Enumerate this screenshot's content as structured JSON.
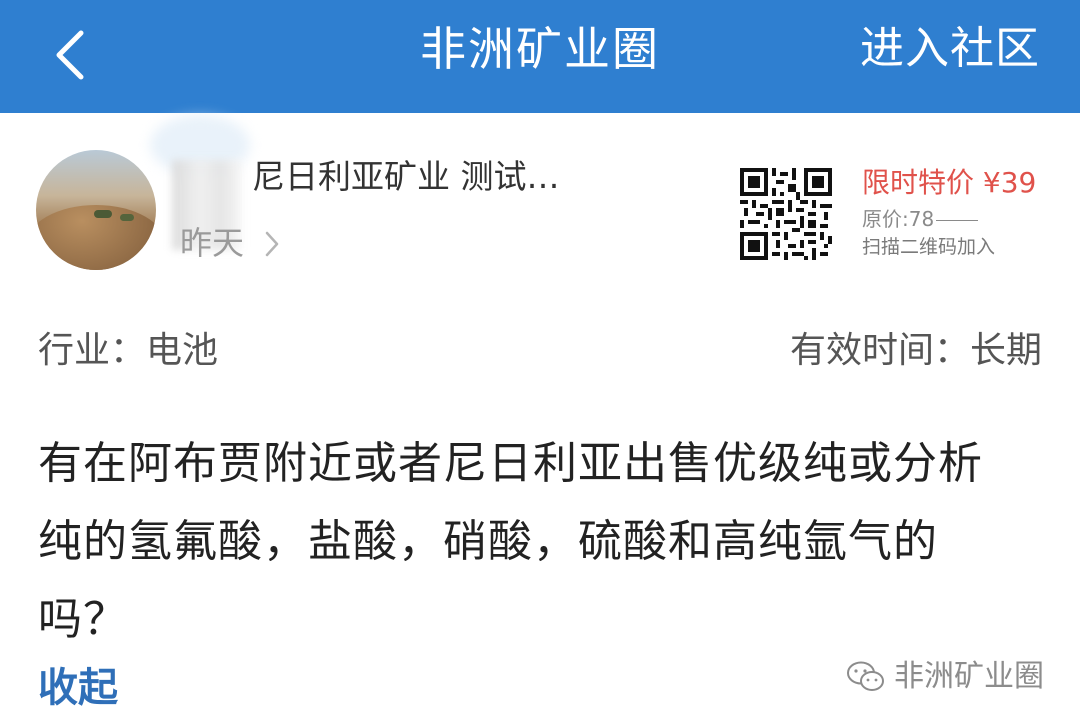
{
  "header": {
    "title": "非洲矿业圈",
    "join_label": "进入社区",
    "bg_color": "#2f7fd0"
  },
  "post": {
    "author_name": "尼日利亚矿业 测试…",
    "time": "昨天",
    "industry_label": "行业：",
    "industry_value": "电池",
    "validity_label": "有效时间：",
    "validity_value": "长期",
    "body_lines": [
      "有在阿布贾附近或者尼日利亚出售优级纯或分析",
      "纯的氢氟酸，盐酸，硝酸，硫酸和高纯氩气的",
      "吗？"
    ],
    "collapse_label": "收起"
  },
  "promo": {
    "price_text": "限时特价 ¥39",
    "original_price_text": "原价:78",
    "scan_tip": "扫描二维码加入",
    "price_color": "#e0524b"
  },
  "watermark": {
    "text": "非洲矿业圈",
    "icon": "wechat-icon"
  }
}
